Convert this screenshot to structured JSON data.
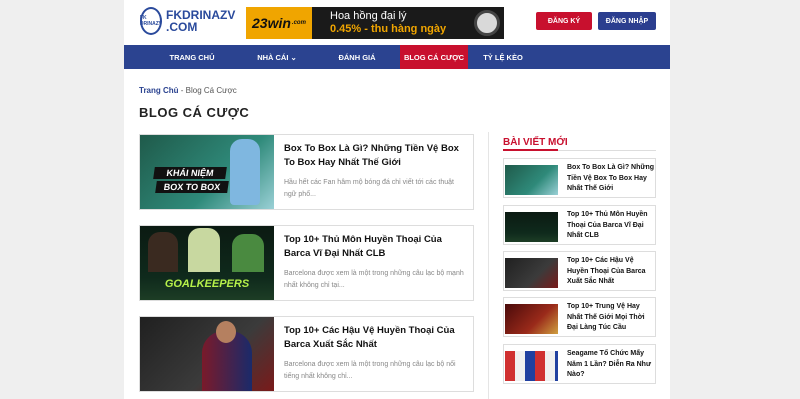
{
  "header": {
    "logo_text_1": "FKDRINAZV",
    "logo_text_2": ".COM",
    "logo_badge": "FK DRINAZV",
    "banner": {
      "brand": "23win",
      "brand_suffix": ".com",
      "line1": "Hoa hồng đại lý",
      "line2": "0.45% - thu hàng ngày"
    },
    "register_label": "ĐĂNG KÝ",
    "login_label": "ĐĂNG NHẬP"
  },
  "nav": [
    {
      "label": "TRANG CHỦ"
    },
    {
      "label": "NHÀ CÁI ⌄"
    },
    {
      "label": "ĐÁNH GIÁ"
    },
    {
      "label": "BLOG CÁ CƯỢC"
    },
    {
      "label": "TỶ LỆ KÈO"
    }
  ],
  "breadcrumb": {
    "home": "Trang Chủ",
    "sep": " - ",
    "current": "Blog Cá Cược"
  },
  "page_title": "BLOG CÁ CƯỢC",
  "posts": [
    {
      "title": "Box To Box Là Gì? Những Tiền Vệ Box To Box Hay Nhất Thế Giới",
      "excerpt": "Hầu hết các Fan hâm mộ bóng đá chỉ viết tới các thuật ngữ phổ...",
      "thumb_caption_1": "KHÁI NIỆM",
      "thumb_caption_2": "BOX TO BOX"
    },
    {
      "title": "Top 10+ Thủ Môn Huyền Thoại Của Barca Vĩ Đại Nhất CLB",
      "excerpt": "Barcelona được xem là một trong những câu lạc bộ mạnh nhất không chỉ tại...",
      "thumb_caption_1": "GOALKEEPERS"
    },
    {
      "title": "Top 10+ Các Hậu Vệ Huyền Thoại Của Barca Xuất Sắc Nhất",
      "excerpt": "Barcelona được xem là một trong những câu lạc bộ nổi tiếng nhất không chỉ..."
    }
  ],
  "sidebar": {
    "title": "BÀI VIẾT MỚI",
    "items": [
      {
        "title": "Box To Box Là Gì? Những Tiền Vệ Box To Box Hay Nhất Thế Giới"
      },
      {
        "title": "Top 10+ Thủ Môn Huyền Thoại Của Barca Vĩ Đại Nhất CLB"
      },
      {
        "title": "Top 10+ Các Hậu Vệ Huyền Thoại Của Barca Xuất Sắc Nhất"
      },
      {
        "title": "Top 10+ Trung Vệ Hay Nhất Thế Giới Mọi Thời Đại Làng Túc Cầu"
      },
      {
        "title": "Seagame Tổ Chức Mấy Năm 1 Lần? Diễn Ra Như Nào?"
      }
    ]
  },
  "colors": {
    "brand_blue": "#2b4390",
    "accent_red": "#c8102e"
  }
}
